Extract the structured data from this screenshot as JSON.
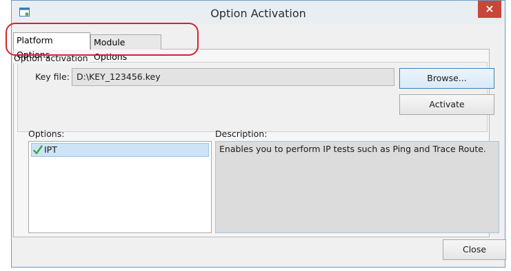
{
  "window": {
    "title": "Option Activation",
    "close_glyph": "×"
  },
  "tabs": [
    {
      "label": "Platform Options",
      "active": true
    },
    {
      "label": "Module Options",
      "active": false
    }
  ],
  "option_activation": {
    "group_label": "Option activation",
    "key_file_label": "Key file:",
    "key_file_value": "D:\\KEY_123456.key",
    "browse_label": "Browse...",
    "activate_label": "Activate"
  },
  "options": {
    "label": "Options:",
    "items": [
      {
        "label": "IPT",
        "checked": true,
        "icon": "check-icon"
      }
    ]
  },
  "description": {
    "label": "Description:",
    "text": "Enables you to perform IP tests such as Ping and Trace Route."
  },
  "footer": {
    "close_label": "Close"
  },
  "colors": {
    "accent": "#3c7fb1",
    "close_button": "#c7473a",
    "annotation": "#d2232a",
    "selection": "#cde3f6"
  }
}
